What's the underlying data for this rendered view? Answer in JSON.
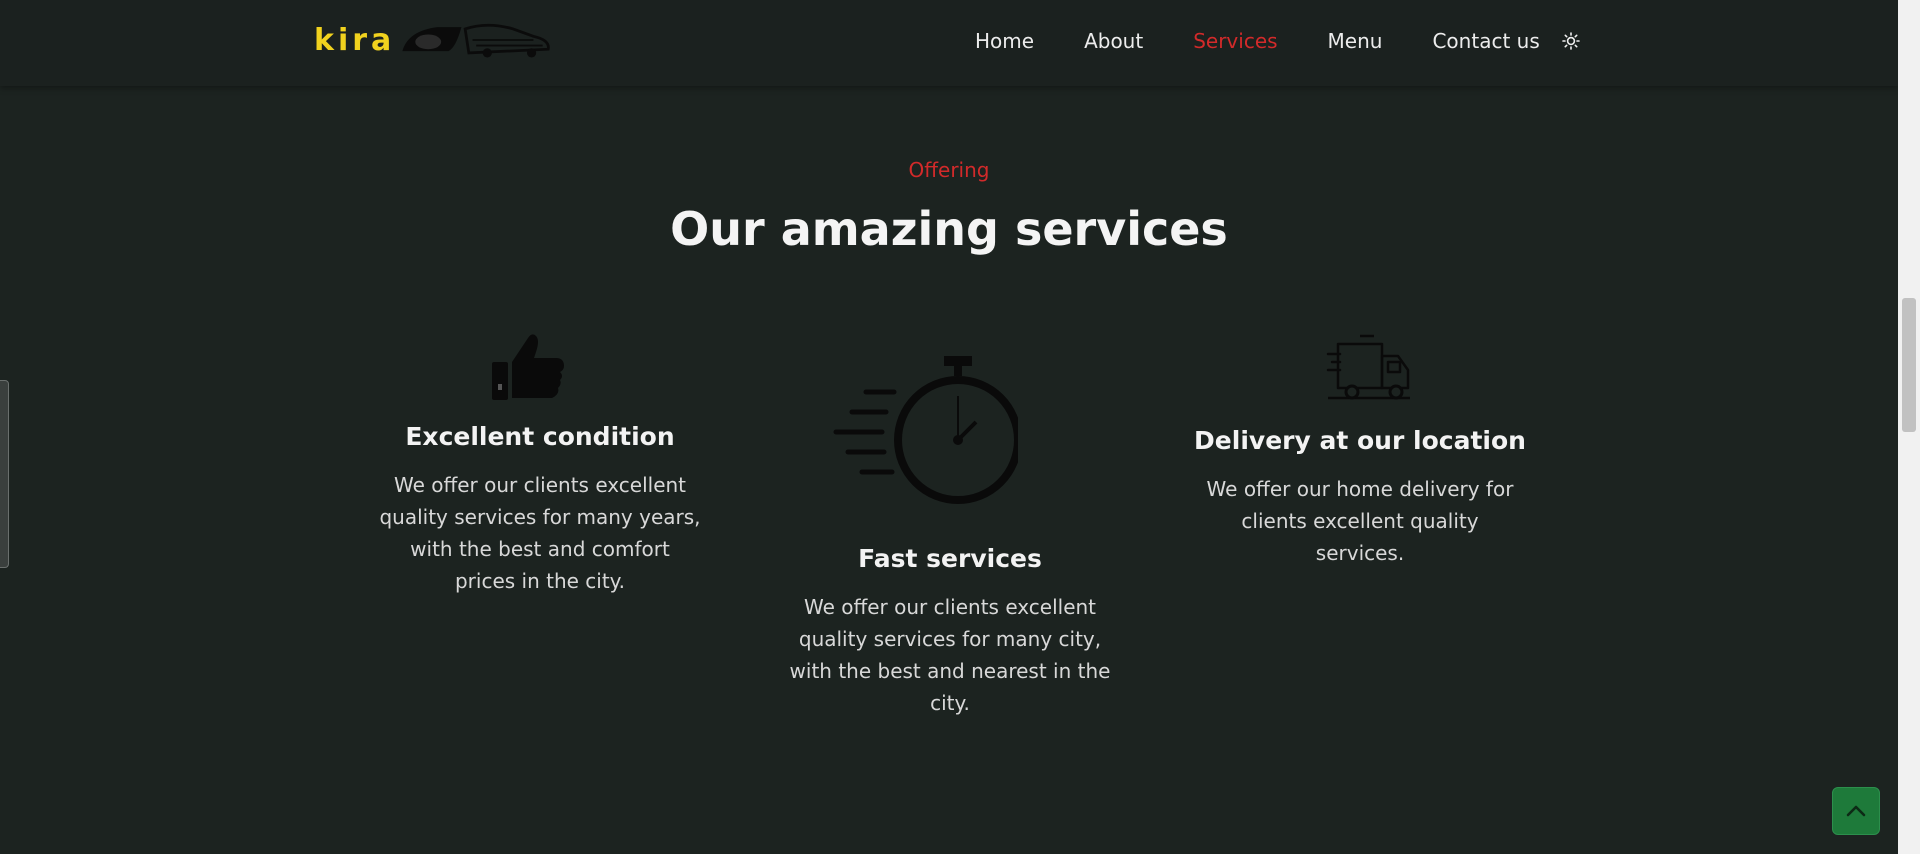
{
  "header": {
    "logo_text": "kira",
    "nav": {
      "home": "Home",
      "about": "About",
      "services": "Services",
      "menu": "Menu",
      "contact": "Contact us"
    }
  },
  "section": {
    "eyebrow": "Offering",
    "title": "Our amazing services"
  },
  "cards": [
    {
      "title": "Excellent condition",
      "lines": [
        "We offer our clients excellent",
        "quality services for many years,",
        "with the best and comfort",
        "prices in the city."
      ]
    },
    {
      "title": "Fast services",
      "lines": [
        "We offer our clients excellent",
        "quality services for many city,",
        "with the best and nearest in the",
        "city."
      ]
    },
    {
      "title": "Delivery at our location",
      "lines": [
        "We offer our home delivery for",
        "clients excellent quality",
        "services."
      ]
    }
  ],
  "icons": {
    "theme": "sun-icon",
    "card1": "thumbs-up-icon",
    "card2": "stopwatch-icon",
    "card3": "delivery-truck-icon",
    "back_to_top": "chevron-up-icon"
  },
  "colors": {
    "background": "#1c2320",
    "accent": "#d22a2a",
    "logo": "#f1d21e",
    "back_to_top": "#1e7a3a"
  }
}
